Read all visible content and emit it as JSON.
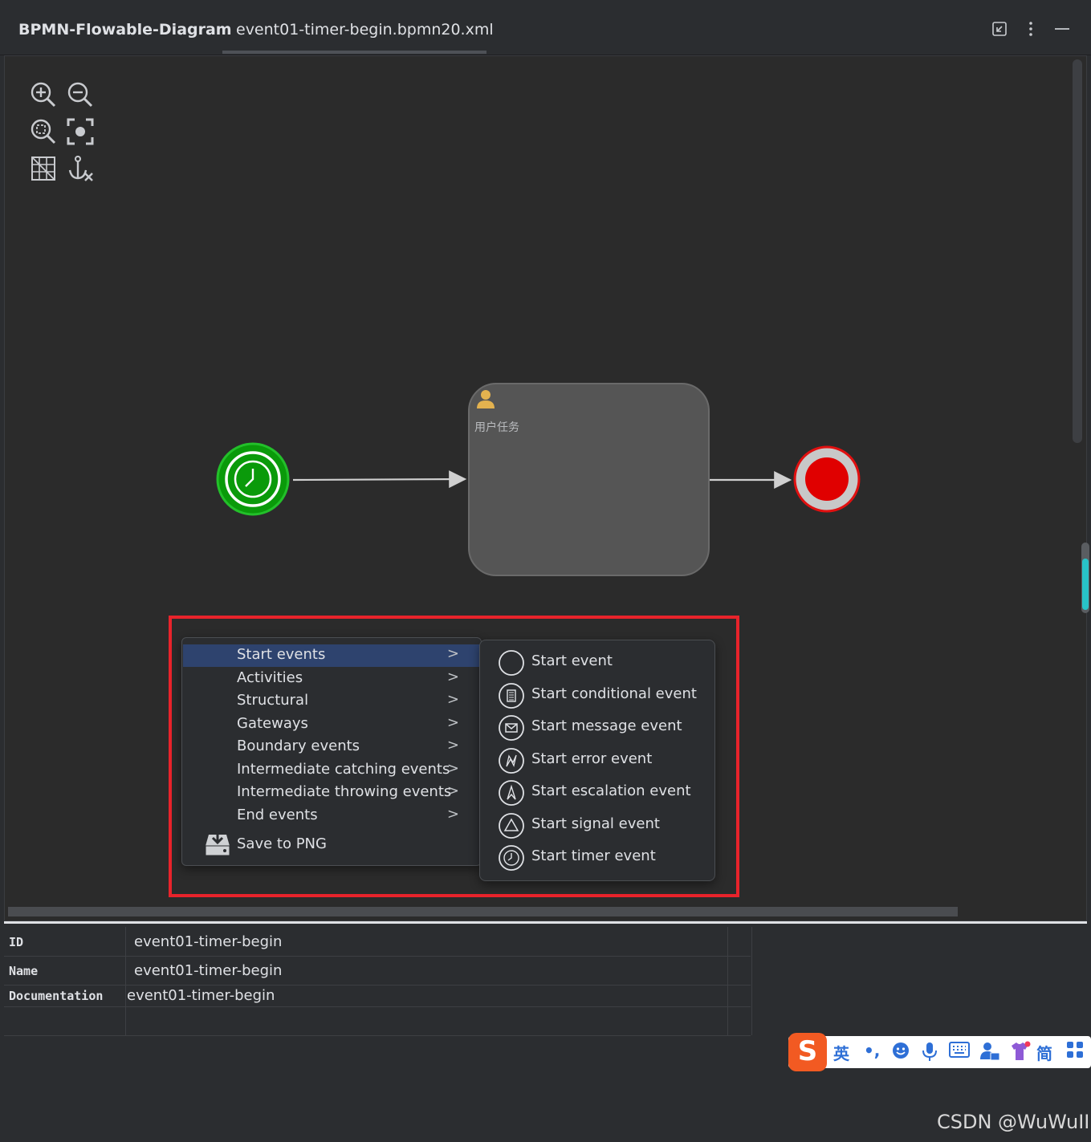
{
  "header": {
    "app_title": "BPMN-Flowable-Diagram",
    "tab_label": "event01-timer-begin.bpmn20.xml",
    "icons": [
      "restore-window-icon",
      "more-vertical-icon",
      "minimize-icon"
    ]
  },
  "toolbar": {
    "icons": [
      "zoom-in-icon",
      "zoom-out-icon",
      "zoom-reset-icon",
      "fit-to-screen-icon",
      "grid-icon",
      "anchor-icon"
    ]
  },
  "diagram": {
    "task_label": "用户任务",
    "start_event_color": "#0a9a0a",
    "end_event_color": "#e00000",
    "task_color": "#555555"
  },
  "context_menu": {
    "items": [
      {
        "label": "Start events",
        "active": true
      },
      {
        "label": "Activities"
      },
      {
        "label": "Structural"
      },
      {
        "label": "Gateways"
      },
      {
        "label": "Boundary events"
      },
      {
        "label": "Intermediate catching events"
      },
      {
        "label": "Intermediate throwing events"
      },
      {
        "label": "End events"
      }
    ],
    "save_label": "Save to PNG",
    "submenu": [
      {
        "label": "Start event",
        "icon": "circle-icon"
      },
      {
        "label": "Start conditional event",
        "icon": "conditional-icon"
      },
      {
        "label": "Start message event",
        "icon": "envelope-icon"
      },
      {
        "label": "Start error event",
        "icon": "error-icon"
      },
      {
        "label": "Start escalation event",
        "icon": "escalation-icon"
      },
      {
        "label": "Start signal event",
        "icon": "triangle-icon"
      },
      {
        "label": "Start timer event",
        "icon": "clock-icon"
      }
    ]
  },
  "properties": {
    "rows": [
      {
        "key": "ID",
        "value": "event01-timer-begin"
      },
      {
        "key": "Name",
        "value": "event01-timer-begin"
      },
      {
        "key": "Documentation",
        "value": "event01-timer-begin"
      },
      {
        "key": "",
        "value": ""
      }
    ]
  },
  "ime": {
    "lang": "英",
    "punct": "•,",
    "mode": "简"
  },
  "watermark": "CSDN @WuWuII"
}
